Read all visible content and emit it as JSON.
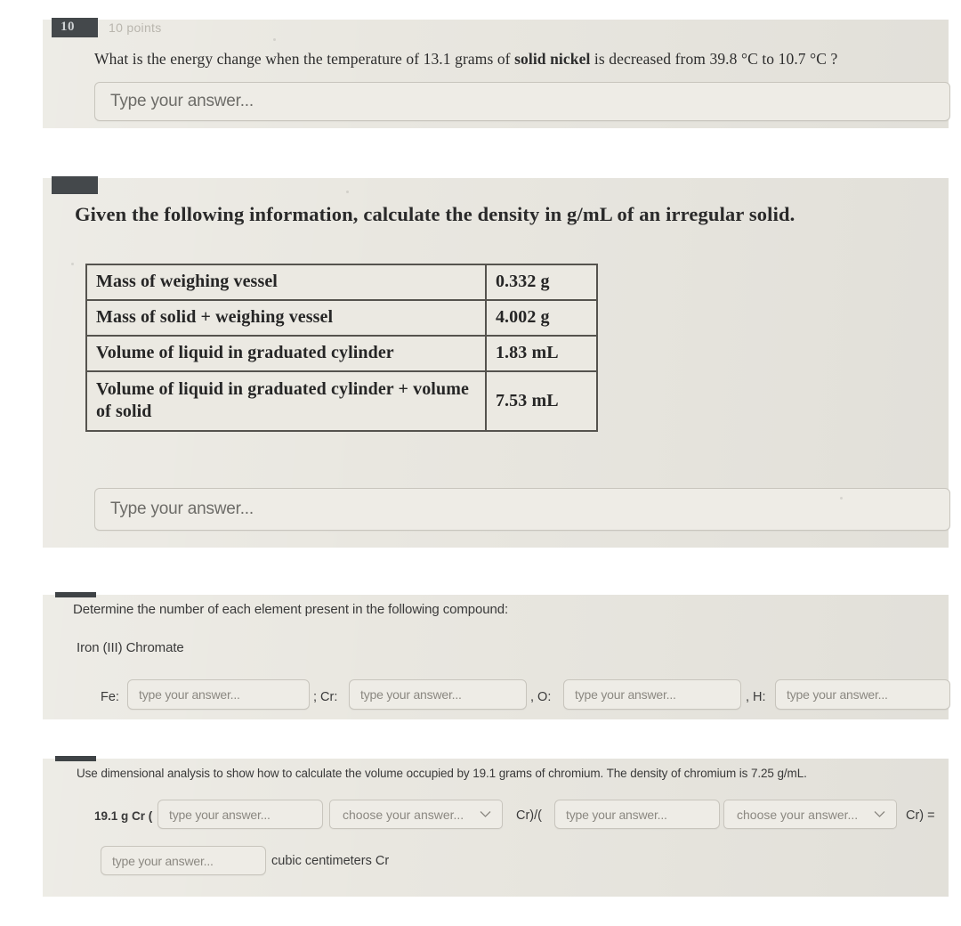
{
  "page": {
    "background": "#ffffff",
    "card_background": "#e9e7e0"
  },
  "questions": [
    {
      "number": "10",
      "points": "10 points",
      "prompt_part1": "What is the energy change when the temperature of 13.1 grams of ",
      "prompt_bold": "solid nickel",
      "prompt_part2": " is decreased from 39.8 °C to 10.7 °C ?",
      "answer_placeholder": "Type your answer..."
    },
    {
      "heading": "Given the following information, calculate the density in g/mL of an irregular solid.",
      "table": {
        "rows": [
          {
            "label": "Mass of weighing vessel",
            "value": "0.332 g"
          },
          {
            "label": "Mass of solid + weighing vessel",
            "value": "4.002 g"
          },
          {
            "label": "Volume of liquid in graduated cylinder",
            "value": "1.83 mL"
          },
          {
            "label": "Volume of liquid in graduated cylinder + volume of solid",
            "value": "7.53 mL"
          }
        ]
      },
      "answer_placeholder": "Type your answer..."
    },
    {
      "prompt": "Determine the number of each element present in the following compound:",
      "compound": "Iron (III) Chromate",
      "fields": [
        {
          "label": "Fe:",
          "placeholder": "type your answer..."
        },
        {
          "label": "; Cr:",
          "placeholder": "type your answer..."
        },
        {
          "label": ", O:",
          "placeholder": "type your answer..."
        },
        {
          "label": ", H:",
          "placeholder": "type your answer..."
        }
      ]
    },
    {
      "prompt": "Use dimensional analysis to show how to calculate the volume occupied by 19.1 grams of chromium. The density of chromium is 7.25 g/mL.",
      "lead_label": "19.1 g Cr (",
      "input1_placeholder": "type your answer...",
      "select1_placeholder": "choose your answer...",
      "mid_label": "Cr)/(",
      "input2_placeholder": "type your answer...",
      "select2_placeholder": "choose your answer...",
      "end_label": "Cr) =",
      "result_placeholder": "type your answer...",
      "unit_label": "cubic centimeters Cr"
    }
  ],
  "icons": {
    "chevron_down": "chevron-down-icon"
  }
}
